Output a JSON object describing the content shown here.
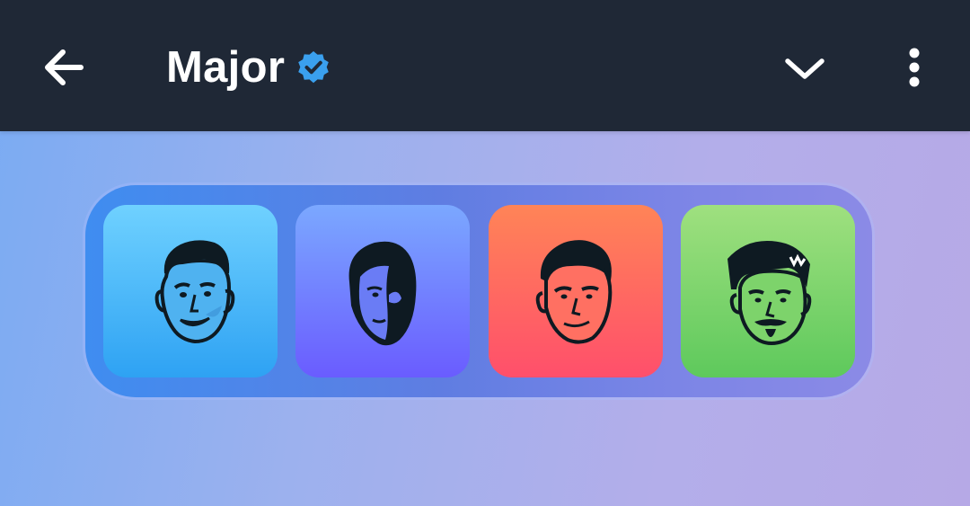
{
  "header": {
    "title": "Major",
    "verified": true,
    "back_icon": "arrow-left-icon",
    "dropdown_icon": "chevron-down-icon",
    "more_icon": "more-vertical-icon"
  },
  "avatars": [
    {
      "icon": "smiling-man-avatar-icon",
      "color_top": "#6fd1ff",
      "color_bottom": "#2ea2f3"
    },
    {
      "icon": "half-shadow-face-avatar-icon",
      "color_top": "#7ba8ff",
      "color_bottom": "#6a5cff"
    },
    {
      "icon": "stern-man-avatar-icon",
      "color_top": "#ff8457",
      "color_bottom": "#ff4f6b"
    },
    {
      "icon": "bearded-man-avatar-icon",
      "color_top": "#9fe07f",
      "color_bottom": "#5ec95c"
    }
  ],
  "colors": {
    "header_bg": "#1f2836",
    "verified_badge": "#3aa0ee",
    "tray": "#5f7de2"
  }
}
